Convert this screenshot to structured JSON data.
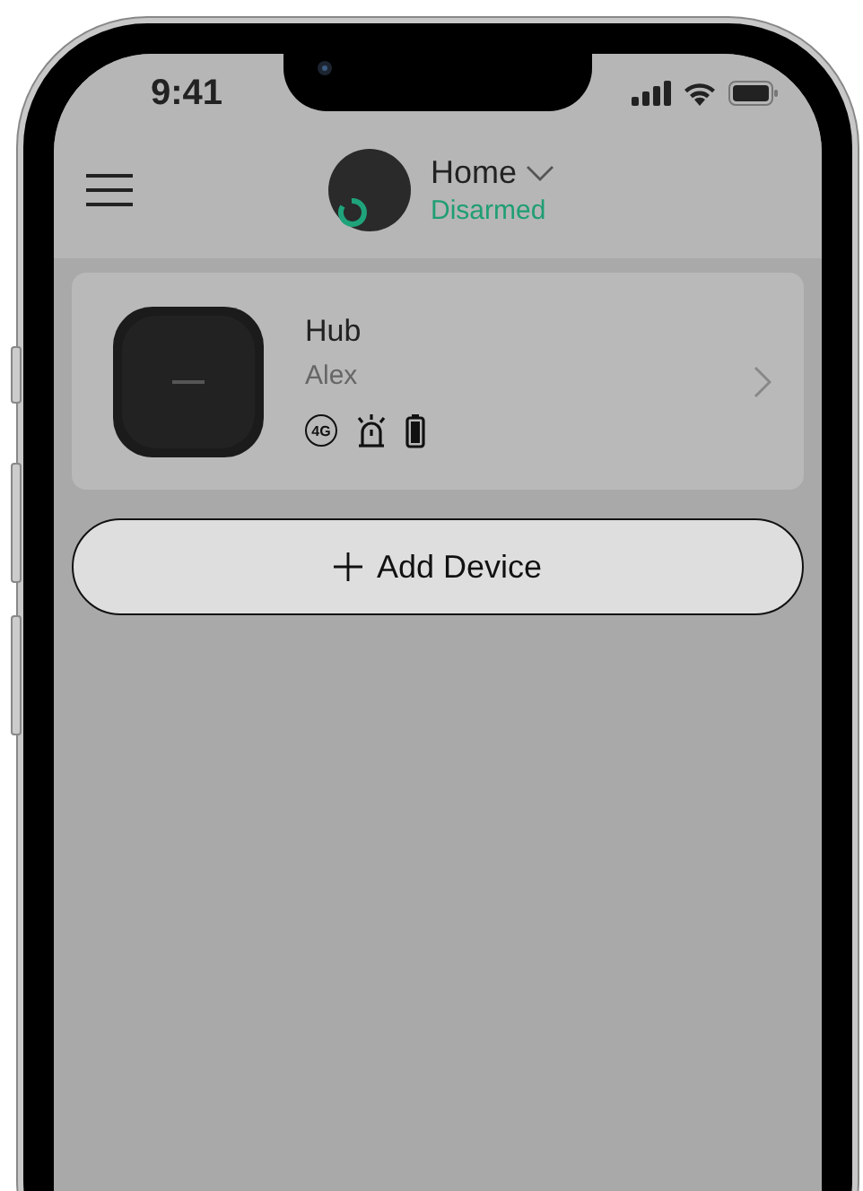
{
  "status_bar": {
    "time": "9:41"
  },
  "header": {
    "title": "Home",
    "status": "Disarmed"
  },
  "devices": [
    {
      "name": "Hub",
      "owner": "Alex",
      "badge": "4G"
    }
  ],
  "add_button": {
    "label": "Add Device"
  }
}
